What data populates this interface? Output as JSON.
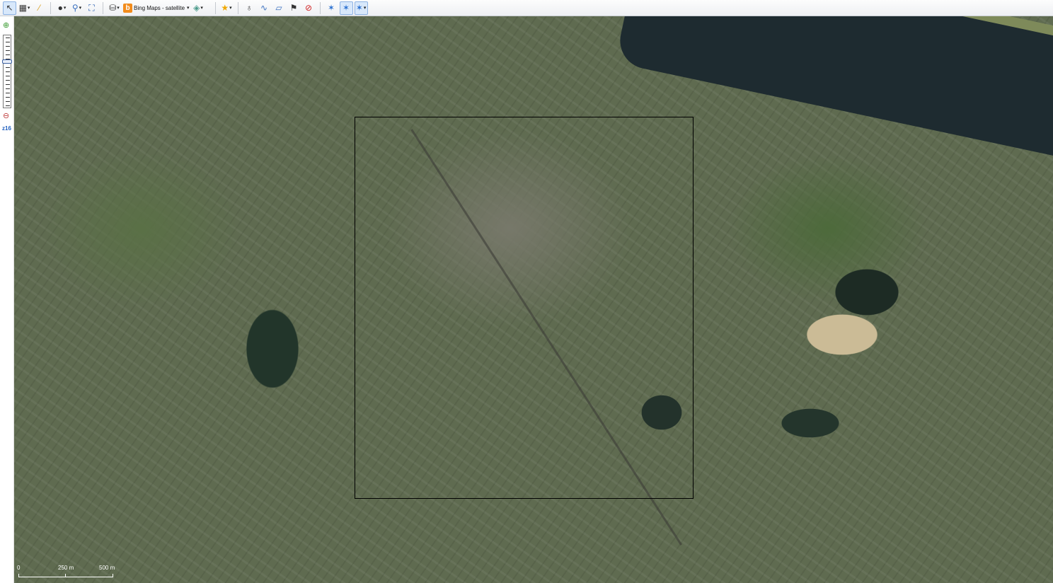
{
  "toolbar": {
    "layer_label": "Bing Maps - satellite",
    "layer_icon": "b"
  },
  "sidebar": {
    "zoom_level": "z16"
  },
  "scale": {
    "zero": "0",
    "mid": "250 m",
    "end": "500 m"
  }
}
